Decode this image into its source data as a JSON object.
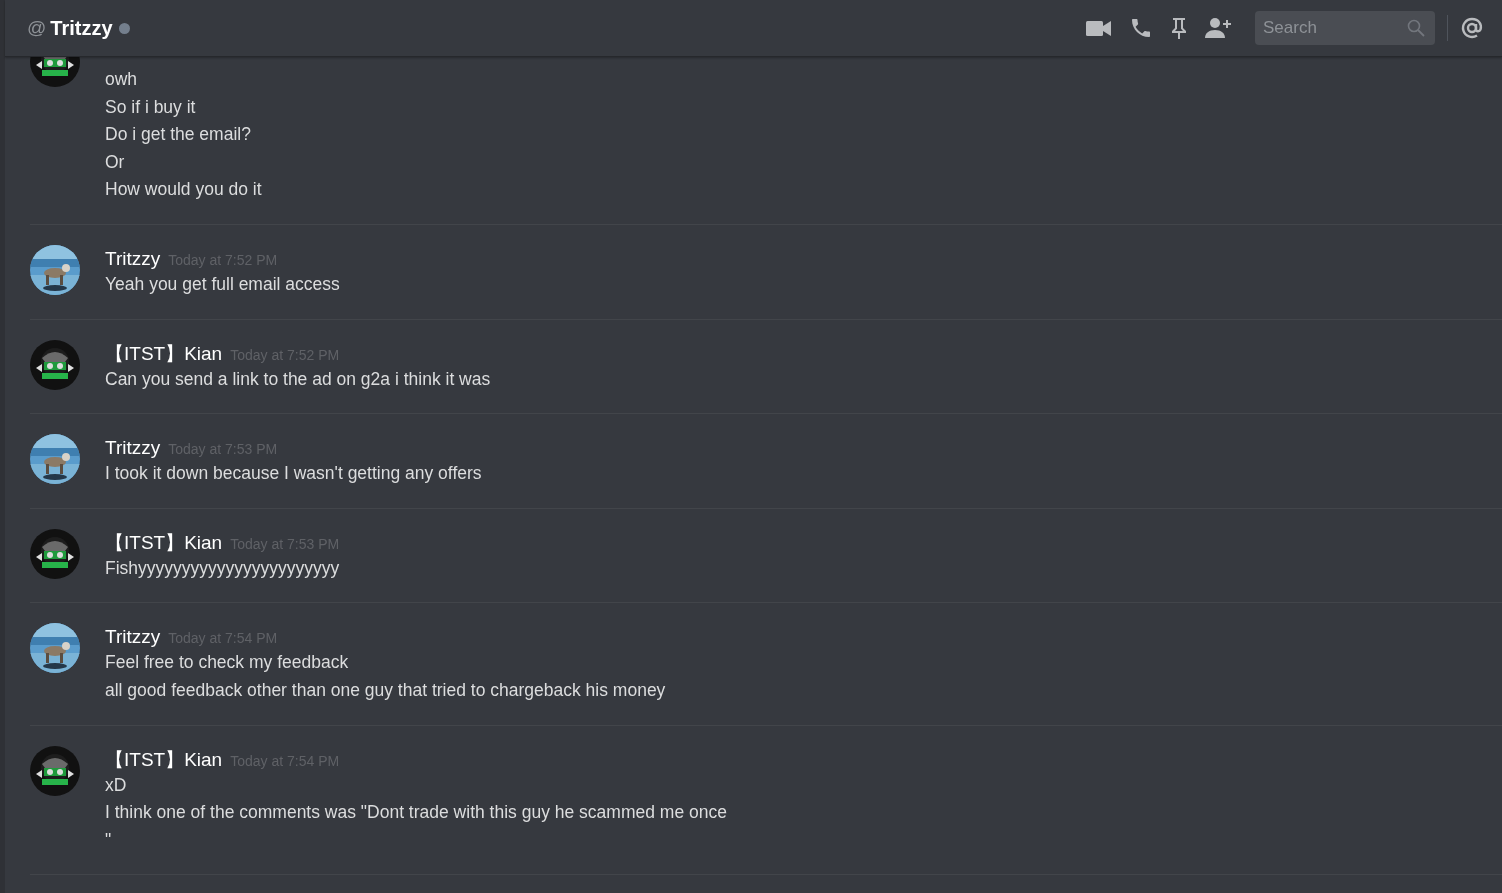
{
  "header": {
    "at_symbol": "@",
    "title": "Tritzzy"
  },
  "search": {
    "placeholder": "Search"
  },
  "messages": [
    {
      "lines": [
        "owh",
        "So if i buy it",
        "Do i get the email?",
        "Or",
        "How would you do it"
      ]
    },
    {
      "author": "Tritzzy",
      "timestamp": "Today at 7:52 PM",
      "lines": [
        "Yeah you get full email access"
      ]
    },
    {
      "author": "【ITST】Kian",
      "timestamp": "Today at 7:52 PM",
      "lines": [
        "Can you send a link to the ad on g2a i think it was"
      ]
    },
    {
      "author": "Tritzzy",
      "timestamp": "Today at 7:53 PM",
      "lines": [
        "I took it down because I wasn't getting any offers"
      ]
    },
    {
      "author": "【ITST】Kian",
      "timestamp": "Today at 7:53 PM",
      "lines": [
        "Fishyyyyyyyyyyyyyyyyyyyyyyy"
      ]
    },
    {
      "author": "Tritzzy",
      "timestamp": "Today at 7:54 PM",
      "lines": [
        "Feel free to check my feedback",
        "all good feedback other than one guy that tried to chargeback his money"
      ]
    },
    {
      "author": "【ITST】Kian",
      "timestamp": "Today at 7:54 PM",
      "lines": [
        "xD",
        "I think one of the comments was \"Dont trade with this guy he scammed me once",
        "\""
      ]
    }
  ]
}
